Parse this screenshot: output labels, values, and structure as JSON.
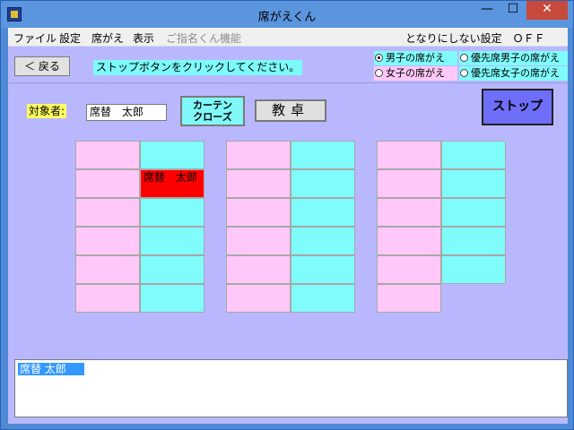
{
  "window": {
    "title": "席がえくん",
    "minimize_symbol": "—",
    "maximize_symbol": "☐",
    "close_symbol": "✕"
  },
  "menu": {
    "items": [
      "ファイル",
      "設定",
      "席がえ",
      "表示"
    ],
    "disabled_item": "ご指名くん機能",
    "right_status": "となりにしない設定　ＯＦＦ"
  },
  "toolbar": {
    "back_label": "＜ 戻る",
    "instruction": "ストップボタンをクリックしてください。",
    "radio_options": [
      {
        "label": "男子の席がえ",
        "selected": true,
        "color": "#80fcfc"
      },
      {
        "label": "優先席男子の席がえ",
        "selected": false,
        "color": "#80fcfc"
      },
      {
        "label": "女子の席がえ",
        "selected": false,
        "color": "#ffc8f8"
      },
      {
        "label": "優先席女子の席がえ",
        "selected": false,
        "color": "#80fcfc"
      }
    ]
  },
  "controls": {
    "target_label": "対象者:",
    "target_value": "席替　太郎",
    "curtain_line1": "カーテン",
    "curtain_line2": "クローズ",
    "teacher_desk": "教卓",
    "stop_label": "ストップ"
  },
  "seats": {
    "blocks": [
      {
        "rows": 6,
        "cols": [
          "pink",
          "cyan"
        ]
      },
      {
        "rows": 6,
        "cols": [
          "pink",
          "cyan"
        ]
      },
      {
        "rows": 6,
        "cols": [
          "pink",
          "cyan"
        ],
        "missing": [
          [
            5,
            1
          ]
        ]
      }
    ],
    "highlighted": {
      "block": 0,
      "row": 1,
      "col": 1,
      "name": "席替　太郎",
      "color": "#ff0000"
    }
  },
  "log": {
    "items": [
      "席替 太郎"
    ]
  },
  "colors": {
    "client_bg": "#b9b8ff",
    "boy_seat": "#80fcfc",
    "girl_seat": "#ffc8f8",
    "stop_button": "#6e6ef8",
    "label_yellow": "#ffff60"
  }
}
